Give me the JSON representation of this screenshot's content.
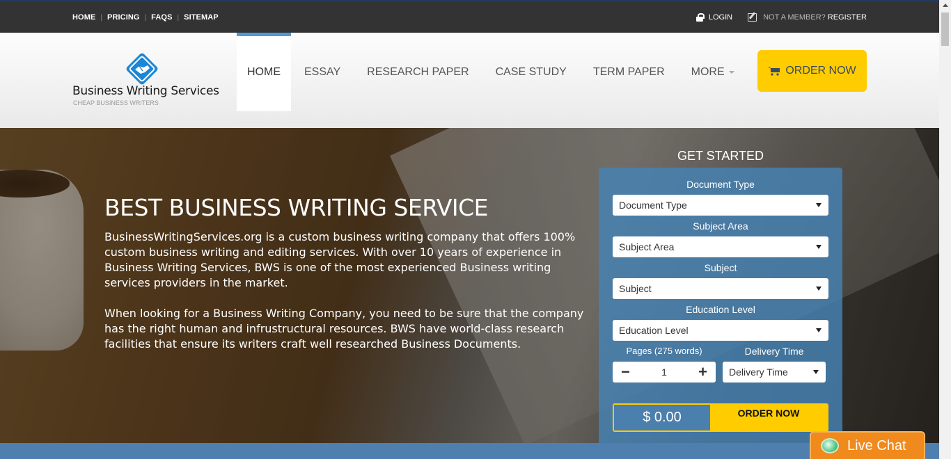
{
  "topbar": {
    "links": [
      "HOME",
      "PRICING",
      "FAQS",
      "SITEMAP"
    ],
    "login": "LOGIN",
    "not_member": "NOT A MEMBER?",
    "register": "REGISTER"
  },
  "logo": {
    "name": "Business Writing Services",
    "tagline": "CHEAP BUSINESS WRITERS"
  },
  "nav": {
    "items": [
      "HOME",
      "ESSAY",
      "RESEARCH PAPER",
      "CASE STUDY",
      "TERM PAPER",
      "MORE"
    ],
    "active": "HOME",
    "order_now": "ORDER NOW"
  },
  "hero": {
    "title": "BEST BUSINESS WRITING SERVICE",
    "paragraph1": "BusinessWritingServices.org is a custom business writing company that offers 100% custom business writing and editing services. With over 10 years of experience in Business Writing Services, BWS is one of the most experienced Business writing services providers in the market.",
    "paragraph2": "When looking for a Business Writing Company, you need to be sure that the company has the right human and infrustructural resources. BWS have world-class research facilities that ensure its writers craft well researched Business Documents."
  },
  "form": {
    "title": "GET STARTED",
    "document_type_label": "Document Type",
    "document_type_value": "Document Type",
    "subject_area_label": "Subject Area",
    "subject_area_value": "Subject Area",
    "subject_label": "Subject",
    "subject_value": "Subject",
    "education_level_label": "Education Level",
    "education_level_value": "Education Level",
    "pages_label": "Pages (275 words)",
    "pages_value": "1",
    "delivery_label": "Delivery Time",
    "delivery_value": "Delivery Time",
    "price": "$ 0.00",
    "order_now": "ORDER NOW"
  },
  "livechat": {
    "label": "Live Chat"
  },
  "colors": {
    "accent_yellow": "#ffcc00",
    "topbar": "#333333",
    "form_blue": "#4682b4",
    "nav_active_border": "#4d9ad6",
    "livechat_orange": "#f08a1c"
  }
}
